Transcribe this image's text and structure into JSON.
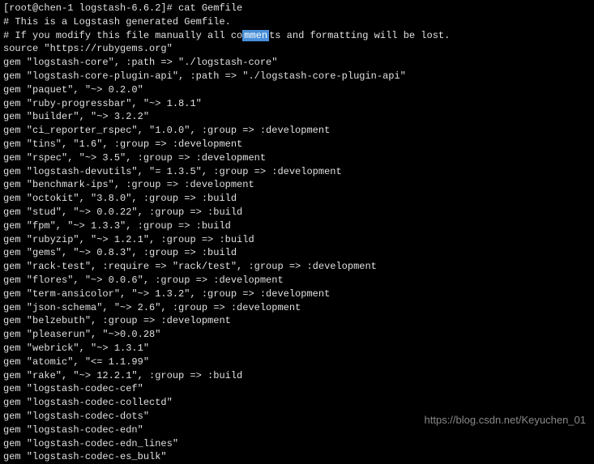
{
  "prompt": "[root@chen-1 logstash-6.6.2]# cat Gemfile",
  "comment1": "# This is a Logstash generated Gemfile.",
  "comment2_prefix": "# If you modify this file manually all co",
  "comment2_highlight": "mmen",
  "comment2_suffix": "ts and formatting will be lost.",
  "lines": [
    "",
    "source \"https://rubygems.org\"",
    "gem \"logstash-core\", :path => \"./logstash-core\"",
    "gem \"logstash-core-plugin-api\", :path => \"./logstash-core-plugin-api\"",
    "gem \"paquet\", \"~> 0.2.0\"",
    "gem \"ruby-progressbar\", \"~> 1.8.1\"",
    "gem \"builder\", \"~> 3.2.2\"",
    "gem \"ci_reporter_rspec\", \"1.0.0\", :group => :development",
    "gem \"tins\", \"1.6\", :group => :development",
    "gem \"rspec\", \"~> 3.5\", :group => :development",
    "gem \"logstash-devutils\", \"= 1.3.5\", :group => :development",
    "gem \"benchmark-ips\", :group => :development",
    "gem \"octokit\", \"3.8.0\", :group => :build",
    "gem \"stud\", \"~> 0.0.22\", :group => :build",
    "gem \"fpm\", \"~> 1.3.3\", :group => :build",
    "gem \"rubyzip\", \"~> 1.2.1\", :group => :build",
    "gem \"gems\", \"~> 0.8.3\", :group => :build",
    "gem \"rack-test\", :require => \"rack/test\", :group => :development",
    "gem \"flores\", \"~> 0.0.6\", :group => :development",
    "gem \"term-ansicolor\", \"~> 1.3.2\", :group => :development",
    "gem \"json-schema\", \"~> 2.6\", :group => :development",
    "gem \"belzebuth\", :group => :development",
    "gem \"pleaserun\", \"~>0.0.28\"",
    "gem \"webrick\", \"~> 1.3.1\"",
    "gem \"atomic\", \"<= 1.1.99\"",
    "gem \"rake\", \"~> 12.2.1\", :group => :build",
    "gem \"logstash-codec-cef\"",
    "gem \"logstash-codec-collectd\"",
    "gem \"logstash-codec-dots\"",
    "gem \"logstash-codec-edn\"",
    "gem \"logstash-codec-edn_lines\"",
    "gem \"logstash-codec-es_bulk\""
  ],
  "watermark": "https://blog.csdn.net/Keyuchen_01"
}
